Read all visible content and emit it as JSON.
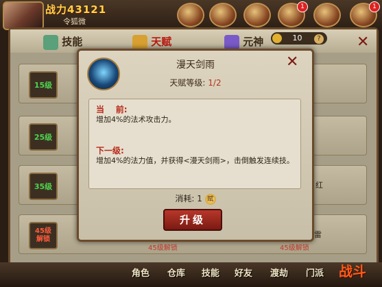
{
  "hud": {
    "power": "战力43121",
    "player_name": "令狐微",
    "icon_badges": [
      "1",
      "1"
    ]
  },
  "panel": {
    "tabs": [
      "技能",
      "天赋",
      "元神"
    ],
    "currency_value": "10",
    "currency_help": "?",
    "close_glyph": "✕",
    "rows": [
      {
        "level": "15级"
      },
      {
        "level": "25级"
      },
      {
        "level": "35级"
      },
      {
        "level": "45级\n解锁",
        "locked": true
      }
    ],
    "unlock_labels": [
      "45级解锁",
      "45级解锁"
    ],
    "right_side_fragments": [
      "红",
      "雷"
    ]
  },
  "dialog": {
    "title": "漫天剑雨",
    "close_glyph": "✕",
    "talent_level_label": "天赋等级:",
    "talent_level_value": "1/2",
    "current_label": "当    前:",
    "current_text": "增加4%的法术攻击力。",
    "next_label": "下一级:",
    "next_text": "增加4%的法力值，并获得<漫天剑雨>，击倒触发连续技。",
    "cost_label": "消耗:",
    "cost_value": "1",
    "cost_icon_glyph": "赋",
    "upgrade_label": "升级"
  },
  "bottom_nav": [
    "角色",
    "仓库",
    "技能",
    "好友",
    "渡劫",
    "门派"
  ],
  "battle_label": "战斗",
  "colors": {
    "accent_red": "#b8281a",
    "level_green": "#4ed34e"
  }
}
